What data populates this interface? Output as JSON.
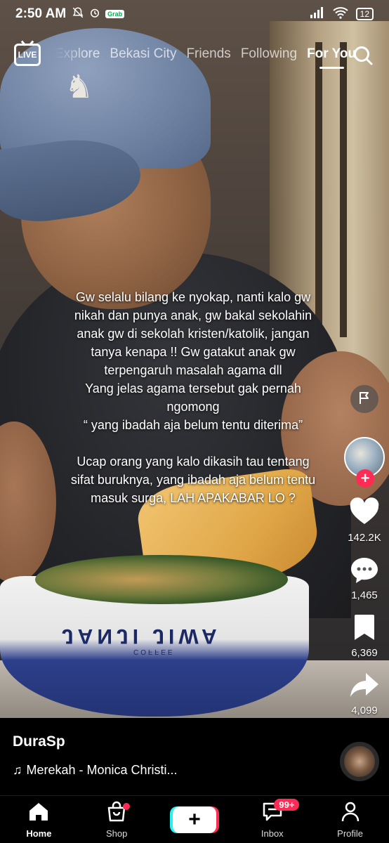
{
  "status_bar": {
    "time": "2:50 AM",
    "grab_label": "Grab",
    "battery": "12",
    "battery_color": "#e53935"
  },
  "top_nav": {
    "live_label": "LIVE",
    "tabs": [
      {
        "label": "Explore"
      },
      {
        "label": "Bekasi City"
      },
      {
        "label": "Friends"
      },
      {
        "label": "Following"
      },
      {
        "label": "For You"
      }
    ],
    "active_tab": "For You"
  },
  "video": {
    "bowl_brand": "JANJI JIWA",
    "bowl_sub": "COFFEE"
  },
  "caption": {
    "lines_1": [
      "Gw selalu bilang ke nyokap, nanti kalo gw",
      "nikah dan punya anak, gw bakal sekolahin",
      "anak gw di sekolah kristen/katolik, jangan",
      "tanya kenapa !! Gw gatakut anak gw",
      "terpengaruh masalah agama dll",
      "Yang jelas agama tersebut gak pernah",
      "ngomong",
      "“ yang ibadah aja belum tentu diterima”"
    ],
    "lines_2": [
      "Ucap orang yang kalo dikasih tau tentang",
      "sifat buruknya, yang ibadah aja belum tentu",
      "masuk surga, LAH APAKABAR LO ?"
    ]
  },
  "rail": {
    "likes": "142.2K",
    "comments": "1,465",
    "bookmarks": "6,369",
    "shares": "4,099"
  },
  "post": {
    "username": "DuraSp",
    "music": "Merekah - Monica Christi..."
  },
  "bottom_nav": {
    "home": "Home",
    "shop": "Shop",
    "inbox": "Inbox",
    "inbox_badge": "99+",
    "profile": "Profile"
  },
  "colors": {
    "accent": "#fe2c55",
    "cyan": "#25f4ee"
  }
}
